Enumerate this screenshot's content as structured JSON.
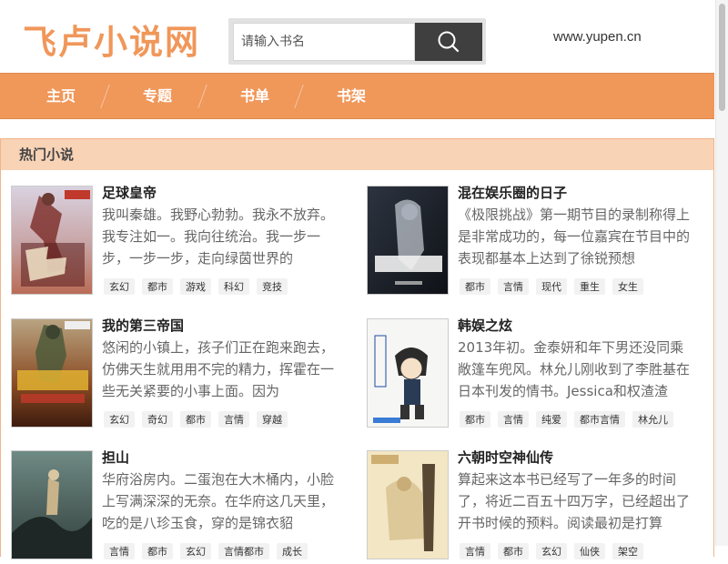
{
  "header": {
    "logo": "飞卢小说网",
    "search_placeholder": "请输入书名",
    "site_url": "www.yupen.cn"
  },
  "nav": {
    "items": [
      {
        "label": "主页"
      },
      {
        "label": "专题"
      },
      {
        "label": "书单"
      },
      {
        "label": "书架"
      }
    ]
  },
  "section": {
    "title": "热门小说"
  },
  "books": [
    {
      "title": "足球皇帝",
      "desc": "我叫秦雄。我野心勃勃。我永不放弃。我专注如一。我向往统治。我一步一步，一步一步，走向绿茵世界的",
      "tags": [
        "玄幻",
        "都市",
        "游戏",
        "科幻",
        "竞技"
      ]
    },
    {
      "title": "混在娱乐圈的日子",
      "desc": "《极限挑战》第一期节目的录制称得上是非常成功的，每一位嘉宾在节目中的表现都基本上达到了徐锐预想",
      "tags": [
        "都市",
        "言情",
        "现代",
        "重生",
        "女生"
      ]
    },
    {
      "title": "我的第三帝国",
      "desc": "悠闲的小镇上，孩子们正在跑来跑去，仿佛天生就用用不完的精力，挥霍在一些无关紧要的小事上面。因为",
      "tags": [
        "玄幻",
        "奇幻",
        "都市",
        "言情",
        "穿越"
      ]
    },
    {
      "title": "韩娱之炫",
      "desc": "2013年初。金泰妍和年下男还没同乘敞篷车兜风。林允儿刚收到了李胜基在日本刊发的情书。Jessica和权渣渣",
      "tags": [
        "都市",
        "言情",
        "纯爱",
        "都市言情",
        "林允儿"
      ]
    },
    {
      "title": "担山",
      "desc": "华府浴房内。二蛋泡在大木桶内，小脸上写满深深的无奈。在华府这几天里，吃的是八珍玉食，穿的是锦衣貂",
      "tags": [
        "言情",
        "都市",
        "玄幻",
        "言情都市",
        "成长"
      ]
    },
    {
      "title": "六朝时空神仙传",
      "desc": "算起来这本书已经写了一年多的时间了，将近二百五十四万字，已经超出了开书时候的预料。阅读最初是打算",
      "tags": [
        "言情",
        "都市",
        "玄幻",
        "仙侠",
        "架空"
      ]
    }
  ],
  "colors": {
    "accent": "#f0975a",
    "section_header_bg": "#f8d3b6",
    "search_button": "#3f3f3f"
  }
}
